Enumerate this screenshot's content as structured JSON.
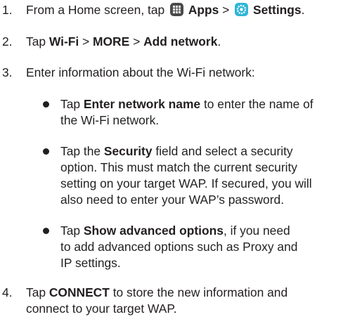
{
  "steps": [
    {
      "number": "1.",
      "parts": [
        "From a Home screen, tap ",
        "Apps",
        " > ",
        "Settings",
        "."
      ]
    },
    {
      "number": "2.",
      "parts": [
        "Tap ",
        "Wi-Fi",
        " > ",
        "MORE",
        " > ",
        "Add network",
        "."
      ]
    },
    {
      "number": "3.",
      "parts": [
        "Enter information about the Wi-Fi network:"
      ]
    },
    {
      "number": "4.",
      "parts": [
        "Tap ",
        "CONNECT",
        " to store the new information and",
        "connect to your target WAP."
      ]
    }
  ],
  "bullets": [
    {
      "parts": [
        "Tap ",
        "Enter network name",
        " to enter the name of",
        "the Wi-Fi network."
      ]
    },
    {
      "parts": [
        "Tap the ",
        "Security",
        " field and select a security",
        "option. This must match the current security",
        "setting on your target WAP. If secured, you will",
        "also need to enter your WAP’s password."
      ]
    },
    {
      "parts": [
        "Tap ",
        "Show advanced options",
        ", if you need",
        "to add advanced options such as Proxy and",
        "IP settings."
      ]
    }
  ],
  "icons": {
    "apps": "apps-grid-icon",
    "settings": "settings-gear-icon",
    "apps_color": "#4a4a4a",
    "settings_color": "#2fb5d8"
  }
}
